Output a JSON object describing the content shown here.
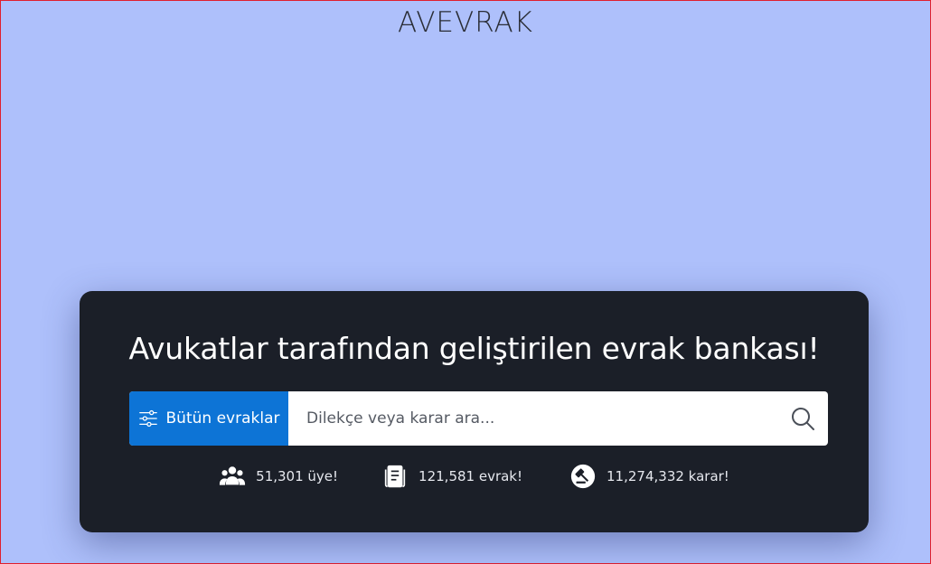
{
  "header": {
    "logo_text": "AVEVRAK"
  },
  "hero": {
    "title": "Avukatlar tarafından geliştirilen evrak bankası!",
    "search": {
      "category_label": "Bütün evraklar",
      "placeholder": "Dilekçe veya karar ara...",
      "icons": {
        "category": "sliders-icon",
        "submit": "search-icon"
      }
    },
    "stats": [
      {
        "icon": "users-icon",
        "text": "51,301 üye!"
      },
      {
        "icon": "document-icon",
        "text": "121,581 evrak!"
      },
      {
        "icon": "gavel-icon",
        "text": "11,274,332 karar!"
      }
    ]
  },
  "colors": {
    "page_background": "#aec0fb",
    "card_background": "#1b1f28",
    "accent_blue": "#0d74d6",
    "window_border": "#e0202e"
  }
}
